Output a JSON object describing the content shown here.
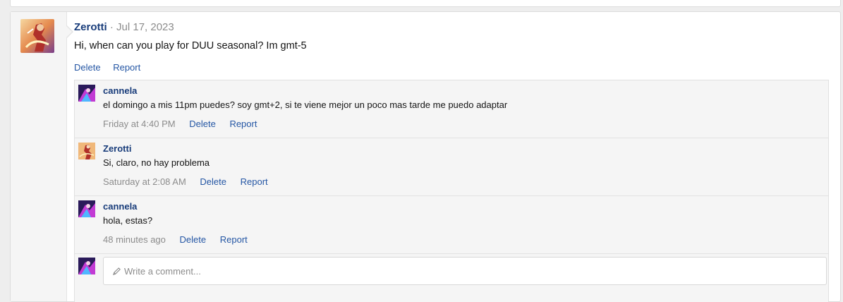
{
  "post": {
    "author": "Zerotti",
    "separator": "·",
    "date": "Jul 17, 2023",
    "body": "Hi, when can you play for DUU seasonal? Im gmt-5",
    "delete_label": "Delete",
    "report_label": "Report"
  },
  "comments": [
    {
      "author": "cannela",
      "text": "el domingo a mis 11pm puedes? soy gmt+2, si te viene mejor un poco mas tarde me puedo adaptar",
      "time": "Friday at 4:40 PM",
      "delete_label": "Delete",
      "report_label": "Report"
    },
    {
      "author": "Zerotti",
      "text": "Si, claro, no hay problema",
      "time": "Saturday at 2:08 AM",
      "delete_label": "Delete",
      "report_label": "Report"
    },
    {
      "author": "cannela",
      "text": "hola, estas?",
      "time": "48 minutes ago",
      "delete_label": "Delete",
      "report_label": "Report"
    }
  ],
  "composer": {
    "placeholder": "Write a comment...",
    "icon": "pencil-icon"
  },
  "colors": {
    "link": "#2456a4",
    "username": "#183c7a",
    "muted": "#8c8c8c"
  }
}
